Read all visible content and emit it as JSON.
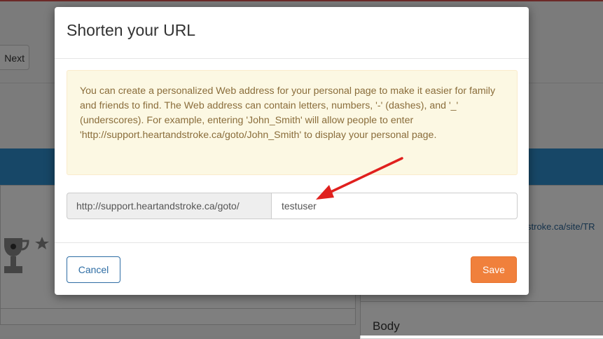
{
  "background": {
    "next_button_label": "Next",
    "link_text": "stroke.ca/site/TR",
    "body_label": "Body",
    "accent_color": "#2f8fcf",
    "trophy_icon": "trophy-icon"
  },
  "modal": {
    "title": "Shorten your URL",
    "info_text": "You can create a personalized Web address for your personal page to make it easier for family and friends to find. The Web address can contain letters, numbers, '-' (dashes), and '_' (underscores). For example, entering 'John_Smith' will allow people to enter 'http://support.heartandstroke.ca/goto/John_Smith' to display your personal page.",
    "url_prefix": "http://support.heartandstroke.ca/goto/",
    "url_value": "testuser",
    "cancel_label": "Cancel",
    "save_label": "Save",
    "save_color": "#f0803c",
    "annotation_icon": "red-arrow-icon"
  }
}
